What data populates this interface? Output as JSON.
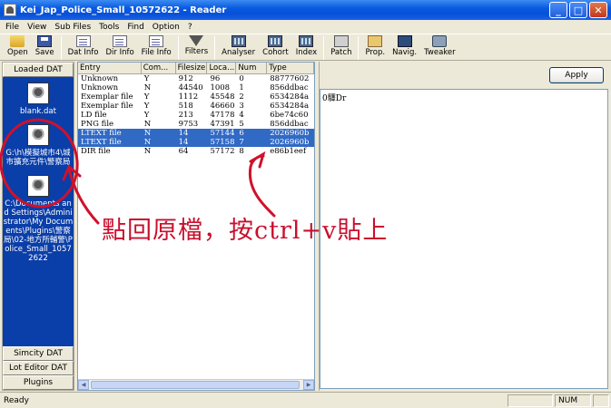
{
  "window": {
    "title": "Kei_Jap_Police_Small_10572622 - Reader",
    "minimize": "_",
    "maximize": "□",
    "close": "✕"
  },
  "menu": [
    "File",
    "View",
    "Sub Files",
    "Tools",
    "Find",
    "Option",
    "?"
  ],
  "toolbar": {
    "open": "Open",
    "save": "Save",
    "dat_info": "Dat Info",
    "dir_info": "Dir Info",
    "file_info": "File Info",
    "filters": "Filters",
    "analyser": "Analyser",
    "cohort": "Cohort",
    "index": "Index",
    "patch": "Patch",
    "prop": "Prop.",
    "navig": "Navig.",
    "tweaker": "Tweaker"
  },
  "left_panel": {
    "header": "Loaded DAT",
    "items": [
      {
        "label": "blank.dat"
      },
      {
        "label": "G:\\h\\模擬城市4\\城市擴充元件\\警察局1.01\\Kei_Jap_Police"
      },
      {
        "label": "C:\\Documents and Settings\\Administrator\\My Documents\\Plugins\\警察局\\02-地方所輔警\\Police_Small_10572622"
      }
    ],
    "footers": [
      "Simcity DAT",
      "Lot Editor DAT",
      "Plugins"
    ]
  },
  "file_list": {
    "columns": [
      "Entry",
      "Com...",
      "Filesize",
      "Loca...",
      "Num",
      "Type"
    ],
    "rows": [
      {
        "entry": "Unknown",
        "com": "Y",
        "size": "912",
        "loc": "96",
        "num": "0",
        "type": "88777602",
        "selected": false
      },
      {
        "entry": "Unknown",
        "com": "N",
        "size": "44540",
        "loc": "1008",
        "num": "1",
        "type": "856ddbac",
        "selected": false
      },
      {
        "entry": "Exemplar file",
        "com": "Y",
        "size": "1112",
        "loc": "45548",
        "num": "2",
        "type": "6534284a",
        "selected": false
      },
      {
        "entry": "Exemplar file",
        "com": "Y",
        "size": "518",
        "loc": "46660",
        "num": "3",
        "type": "6534284a",
        "selected": false
      },
      {
        "entry": "LD file",
        "com": "Y",
        "size": "213",
        "loc": "47178",
        "num": "4",
        "type": "6be74c60",
        "selected": false
      },
      {
        "entry": "PNG file",
        "com": "N",
        "size": "9753",
        "loc": "47391",
        "num": "5",
        "type": "856ddbac",
        "selected": false
      },
      {
        "entry": "LTEXT file",
        "com": "N",
        "size": "14",
        "loc": "57144",
        "num": "6",
        "type": "2026960b",
        "selected": true
      },
      {
        "entry": "LTEXT file",
        "com": "N",
        "size": "14",
        "loc": "57158",
        "num": "7",
        "type": "2026960b",
        "selected": true
      },
      {
        "entry": "DIR file",
        "com": "N",
        "size": "64",
        "loc": "57172",
        "num": "8",
        "type": "e86b1eef",
        "selected": false
      }
    ]
  },
  "right_panel": {
    "apply": "Apply",
    "content": "0驛Dr"
  },
  "status": {
    "text": "Ready",
    "num": "NUM"
  },
  "annotation": {
    "text": "點回原檔，按ctrl+v貼上",
    "color": "#c8102e"
  }
}
